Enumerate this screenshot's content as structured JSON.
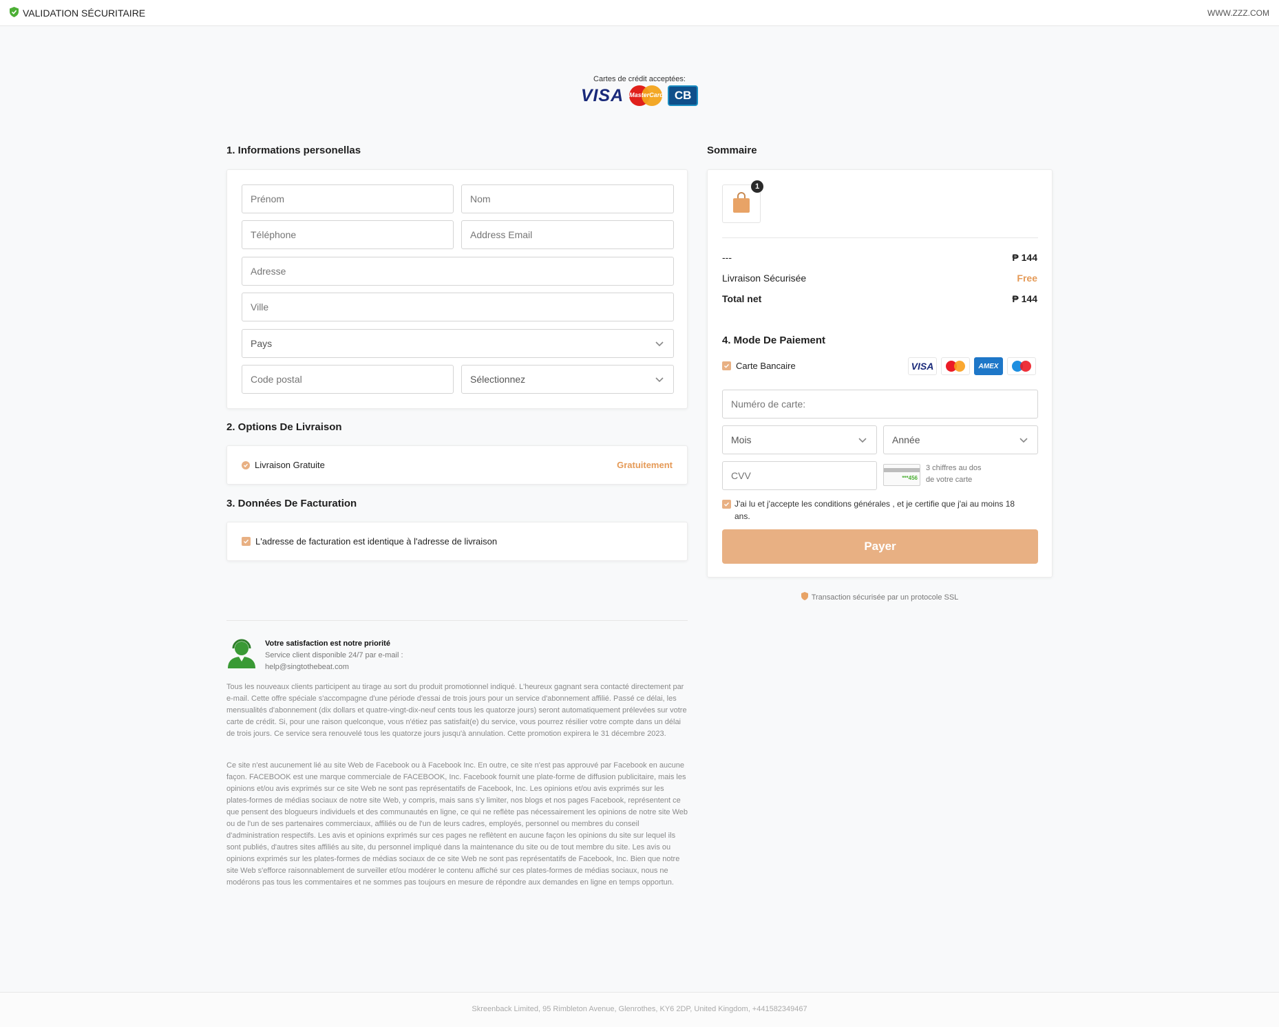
{
  "header": {
    "title": "VALIDATION SÉCURITAIRE",
    "site": "WWW.ZZZ.COM"
  },
  "accepted_cards": {
    "label": "Cartes de crédit acceptées:",
    "visa": "VISA",
    "mastercard": "MasterCard",
    "cb": "CB"
  },
  "personal": {
    "title": "1. Informations personellas",
    "first_name_placeholder": "Prénom",
    "last_name_placeholder": "Nom",
    "phone_placeholder": "Téléphone",
    "email_placeholder": "Address Email",
    "address_placeholder": "Adresse",
    "city_placeholder": "Ville",
    "country_select": "Pays",
    "postal_placeholder": "Code postal",
    "region_select": "Sélectionnez"
  },
  "shipping": {
    "title": "2. Options De Livraison",
    "option_label": "Livraison Gratuite",
    "option_price": "Gratuitement"
  },
  "billing": {
    "title": "3. Données De Facturation",
    "same_address_label": "L'adresse de facturation est identique à l'adresse de livraison"
  },
  "summary": {
    "title": "Sommaire",
    "cart_count": "1",
    "item_label": "---",
    "item_price": "₱ 144",
    "shipping_label": "Livraison Sécurisée",
    "shipping_value": "Free",
    "total_label": "Total net",
    "total_value": "₱ 144"
  },
  "payment": {
    "title": "4. Mode De Paiement",
    "method_label": "Carte Bancaire",
    "logos": {
      "visa": "VISA",
      "amex": "AMEX"
    },
    "card_number_placeholder": "Numéro de carte:",
    "month_select": "Mois",
    "year_select": "Année",
    "cvv_placeholder": "CVV",
    "cvv_sample": "***456",
    "cvv_hint_line1": "3 chiffres au dos",
    "cvv_hint_line2": "de votre carte",
    "terms_line1": "J'ai lu et j'accepte les conditions générales , et je certifie que j'ai au moins 18",
    "terms_line2": "ans.",
    "pay_button": "Payer",
    "ssl_note": "Transaction sécurisée par un protocole SSL"
  },
  "support": {
    "title": "Votre satisfaction est notre priorité",
    "line1": "Service client disponible 24/7 par e-mail :",
    "email": "help@singtothebeat.com"
  },
  "legal": {
    "paragraph1": "Tous les nouveaux clients participent au tirage au sort du produit promotionnel indiqué. L'heureux gagnant sera contacté directement par e-mail. Cette offre spéciale s'accompagne d'une période d'essai de trois jours pour un service d'abonnement affilié. Passé ce délai, les mensualités d'abonnement (dix dollars et quatre-vingt-dix-neuf cents tous les quatorze jours) seront automatiquement prélevées sur votre carte de crédit. Si, pour une raison quelconque, vous n'étiez pas satisfait(e) du service, vous pourrez résilier votre compte dans un délai de trois jours. Ce service sera renouvelé tous les quatorze jours jusqu'à annulation. Cette promotion expirera le 31 décembre 2023.",
    "paragraph2": "Ce site n'est aucunement lié au site Web de Facebook ou à Facebook Inc. En outre, ce site n'est pas approuvé par Facebook en aucune façon. FACEBOOK est une marque commerciale de FACEBOOK, Inc. Facebook fournit une plate-forme de diffusion publicitaire, mais les opinions et/ou avis exprimés sur ce site Web ne sont pas représentatifs de Facebook, Inc. Les opinions et/ou avis exprimés sur les plates-formes de médias sociaux de notre site Web, y compris, mais sans s'y limiter, nos blogs et nos pages Facebook, représentent ce que pensent des blogueurs individuels et des communautés en ligne, ce qui ne reflète pas nécessairement les opinions de notre site Web ou de l'un de ses partenaires commerciaux, affiliés ou de l'un de leurs cadres, employés, personnel ou membres du conseil d'administration respectifs. Les avis et opinions exprimés sur ces pages ne reflètent en aucune façon les opinions du site sur lequel ils sont publiés, d'autres sites affiliés au site, du personnel impliqué dans la maintenance du site ou de tout membre du site. Les avis ou opinions exprimés sur les plates-formes de médias sociaux de ce site Web ne sont pas représentatifs de Facebook, Inc. Bien que notre site Web s'efforce raisonnablement de surveiller et/ou modérer le contenu affiché sur ces plates-formes de médias sociaux, nous ne modérons pas tous les commentaires et ne sommes pas toujours en mesure de répondre aux demandes en ligne en temps opportun."
  },
  "footer": {
    "text": "Skreenback Limited, 95 Rimbleton Avenue, Glenrothes, KY6 2DP, United Kingdom, +441582349467"
  },
  "colors": {
    "accent": "#e8b083",
    "accent_text": "#e59a57",
    "shield_green": "#4caf35"
  }
}
